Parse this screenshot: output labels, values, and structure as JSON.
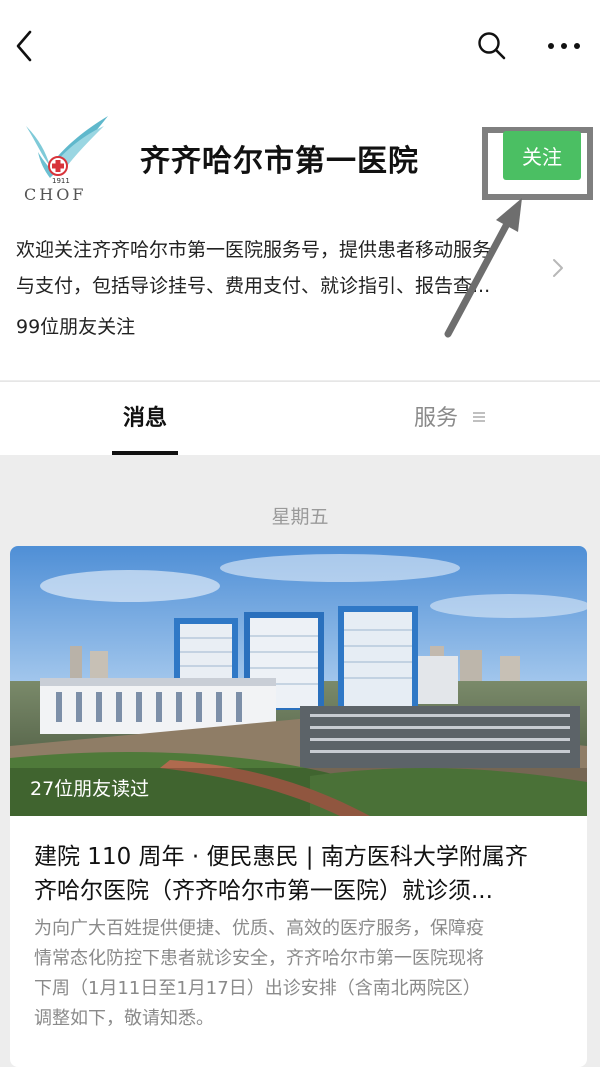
{
  "nav": {
    "back_icon": "chevron-left-icon",
    "search_icon": "search-icon",
    "more_icon": "more-dots-icon"
  },
  "account": {
    "logo_icon": "hospital-crane-logo",
    "logo_text": "1911 CHOF",
    "name": "齐齐哈尔市第一医院",
    "follow_label": "关注",
    "follow_color": "#4bbf63",
    "description_line1": "欢迎关注齐齐哈尔市第一医院服务号，提供患者移动服务",
    "description_line2": "与支付，包括导诊挂号、费用支付、就诊指引、报告查...",
    "followers": "99位朋友关注"
  },
  "tabs": [
    {
      "label": "消息",
      "active": true
    },
    {
      "label": "服务",
      "active": false
    }
  ],
  "feed": {
    "date": "星期五",
    "article": {
      "read_count": "27位朋友读过",
      "title_line1": "建院 110 周年 · 便民惠民 | 南方医科大学附属齐",
      "title_line2": "齐哈尔医院（齐齐哈尔市第一医院）就诊须...",
      "summary_line1": "为向广大百姓提供便捷、优质、高效的医疗服务，保障疫",
      "summary_line2": "情常态化防控下患者就诊安全，齐齐哈尔市第一医院现将",
      "summary_line3": "下周（1月11日至1月17日）出诊安排（含南北两院区）",
      "summary_line4": "调整如下，敬请知悉。"
    }
  }
}
